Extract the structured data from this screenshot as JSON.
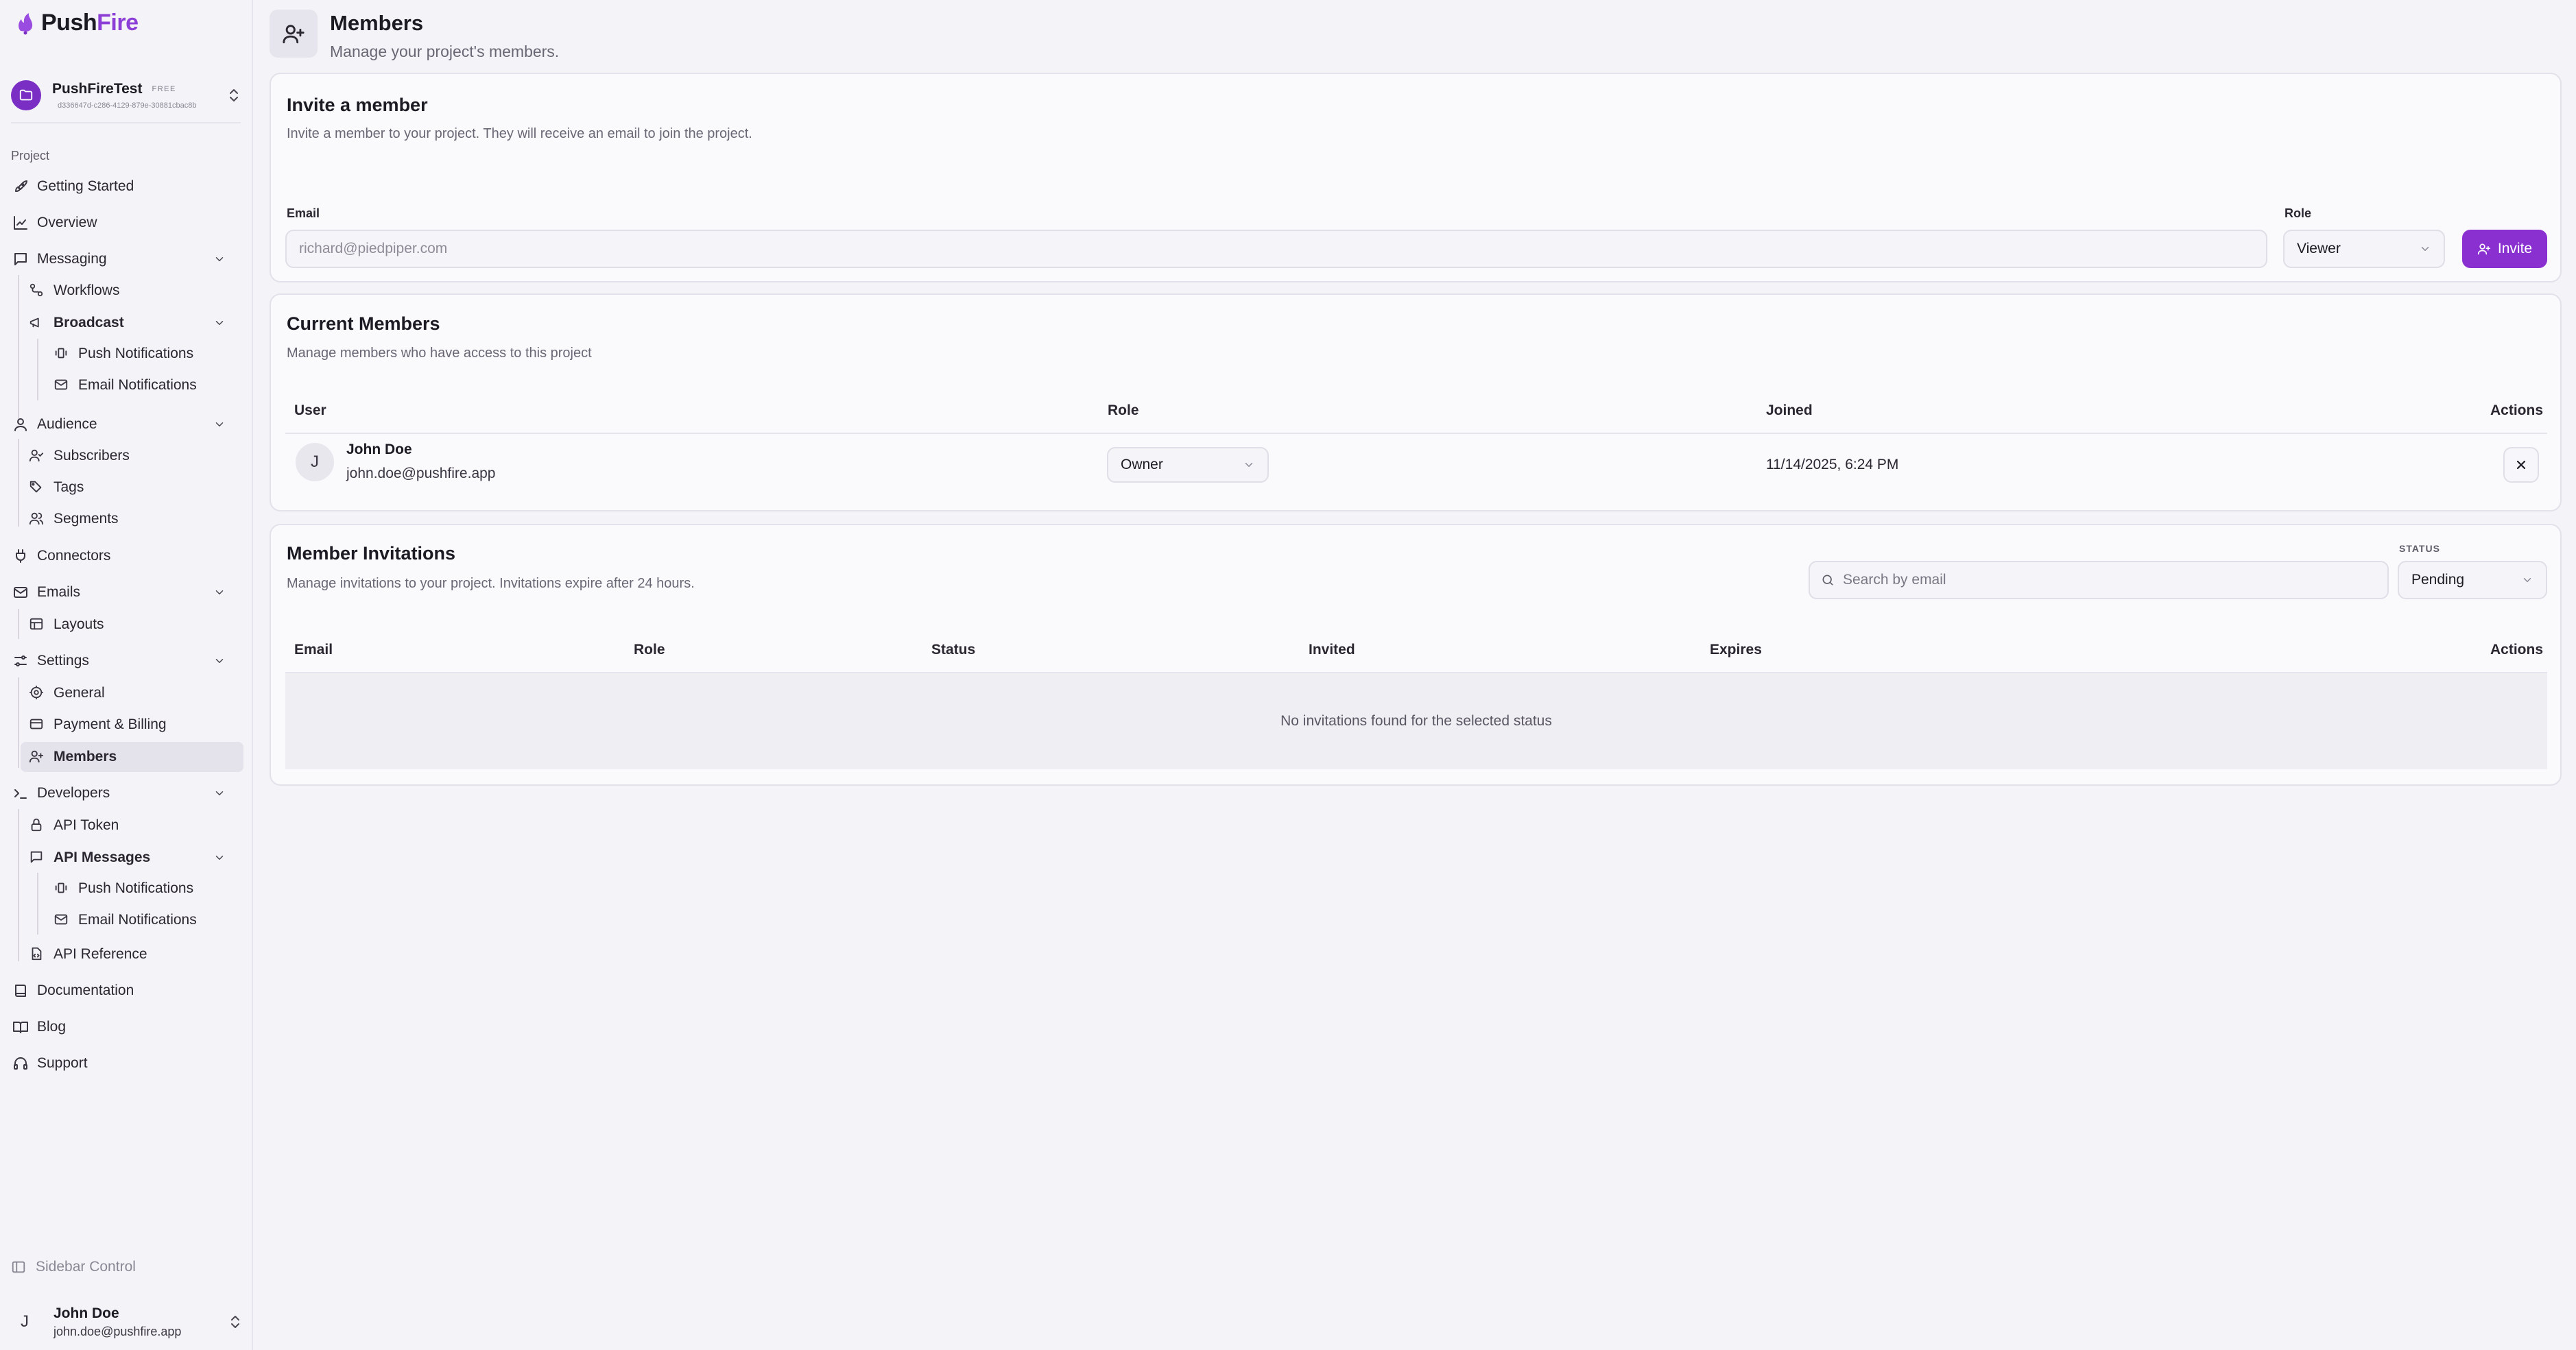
{
  "brand": {
    "name_part1": "Push",
    "name_part2": "Fire",
    "accent": "#8a2fd0"
  },
  "project": {
    "name": "PushFireTest",
    "badge": "FREE",
    "id": "d336647d-c286-4129-879e-30881cbac8b"
  },
  "sidebar": {
    "group_label": "Project",
    "items": {
      "getting_started": "Getting Started",
      "overview": "Overview",
      "messaging": "Messaging",
      "workflows": "Workflows",
      "broadcast": "Broadcast",
      "broadcast_push": "Push Notifications",
      "broadcast_email": "Email Notifications",
      "audience": "Audience",
      "subscribers": "Subscribers",
      "tags": "Tags",
      "segments": "Segments",
      "connectors": "Connectors",
      "emails": "Emails",
      "layouts": "Layouts",
      "settings": "Settings",
      "general": "General",
      "payment_billing": "Payment & Billing",
      "members": "Members",
      "developers": "Developers",
      "api_token": "API Token",
      "api_messages": "API Messages",
      "api_push": "Push Notifications",
      "api_email": "Email Notifications",
      "api_reference": "API Reference",
      "documentation": "Documentation",
      "blog": "Blog",
      "support": "Support"
    },
    "sidebar_control": "Sidebar Control",
    "user": {
      "initial": "J",
      "name": "John Doe",
      "email": "john.doe@pushfire.app"
    }
  },
  "page": {
    "title": "Members",
    "subtitle": "Manage your project's members."
  },
  "invite": {
    "title": "Invite a member",
    "description": "Invite a member to your project. They will receive an email to join the project.",
    "email_label": "Email",
    "email_placeholder": "richard@piedpiper.com",
    "role_label": "Role",
    "role_value": "Viewer",
    "button_label": "Invite"
  },
  "current_members": {
    "title": "Current Members",
    "description": "Manage members who have access to this project",
    "columns": {
      "user": "User",
      "role": "Role",
      "joined": "Joined",
      "actions": "Actions"
    },
    "rows": [
      {
        "initial": "J",
        "name": "John Doe",
        "email": "john.doe@pushfire.app",
        "role": "Owner",
        "joined": "11/14/2025, 6:24 PM"
      }
    ]
  },
  "invitations": {
    "title": "Member Invitations",
    "description": "Manage invitations to your project. Invitations expire after 24 hours.",
    "search_placeholder": "Search by email",
    "status_label": "STATUS",
    "status_value": "Pending",
    "columns": {
      "email": "Email",
      "role": "Role",
      "status": "Status",
      "invited": "Invited",
      "expires": "Expires",
      "actions": "Actions"
    },
    "empty_message": "No invitations found for the selected status"
  }
}
